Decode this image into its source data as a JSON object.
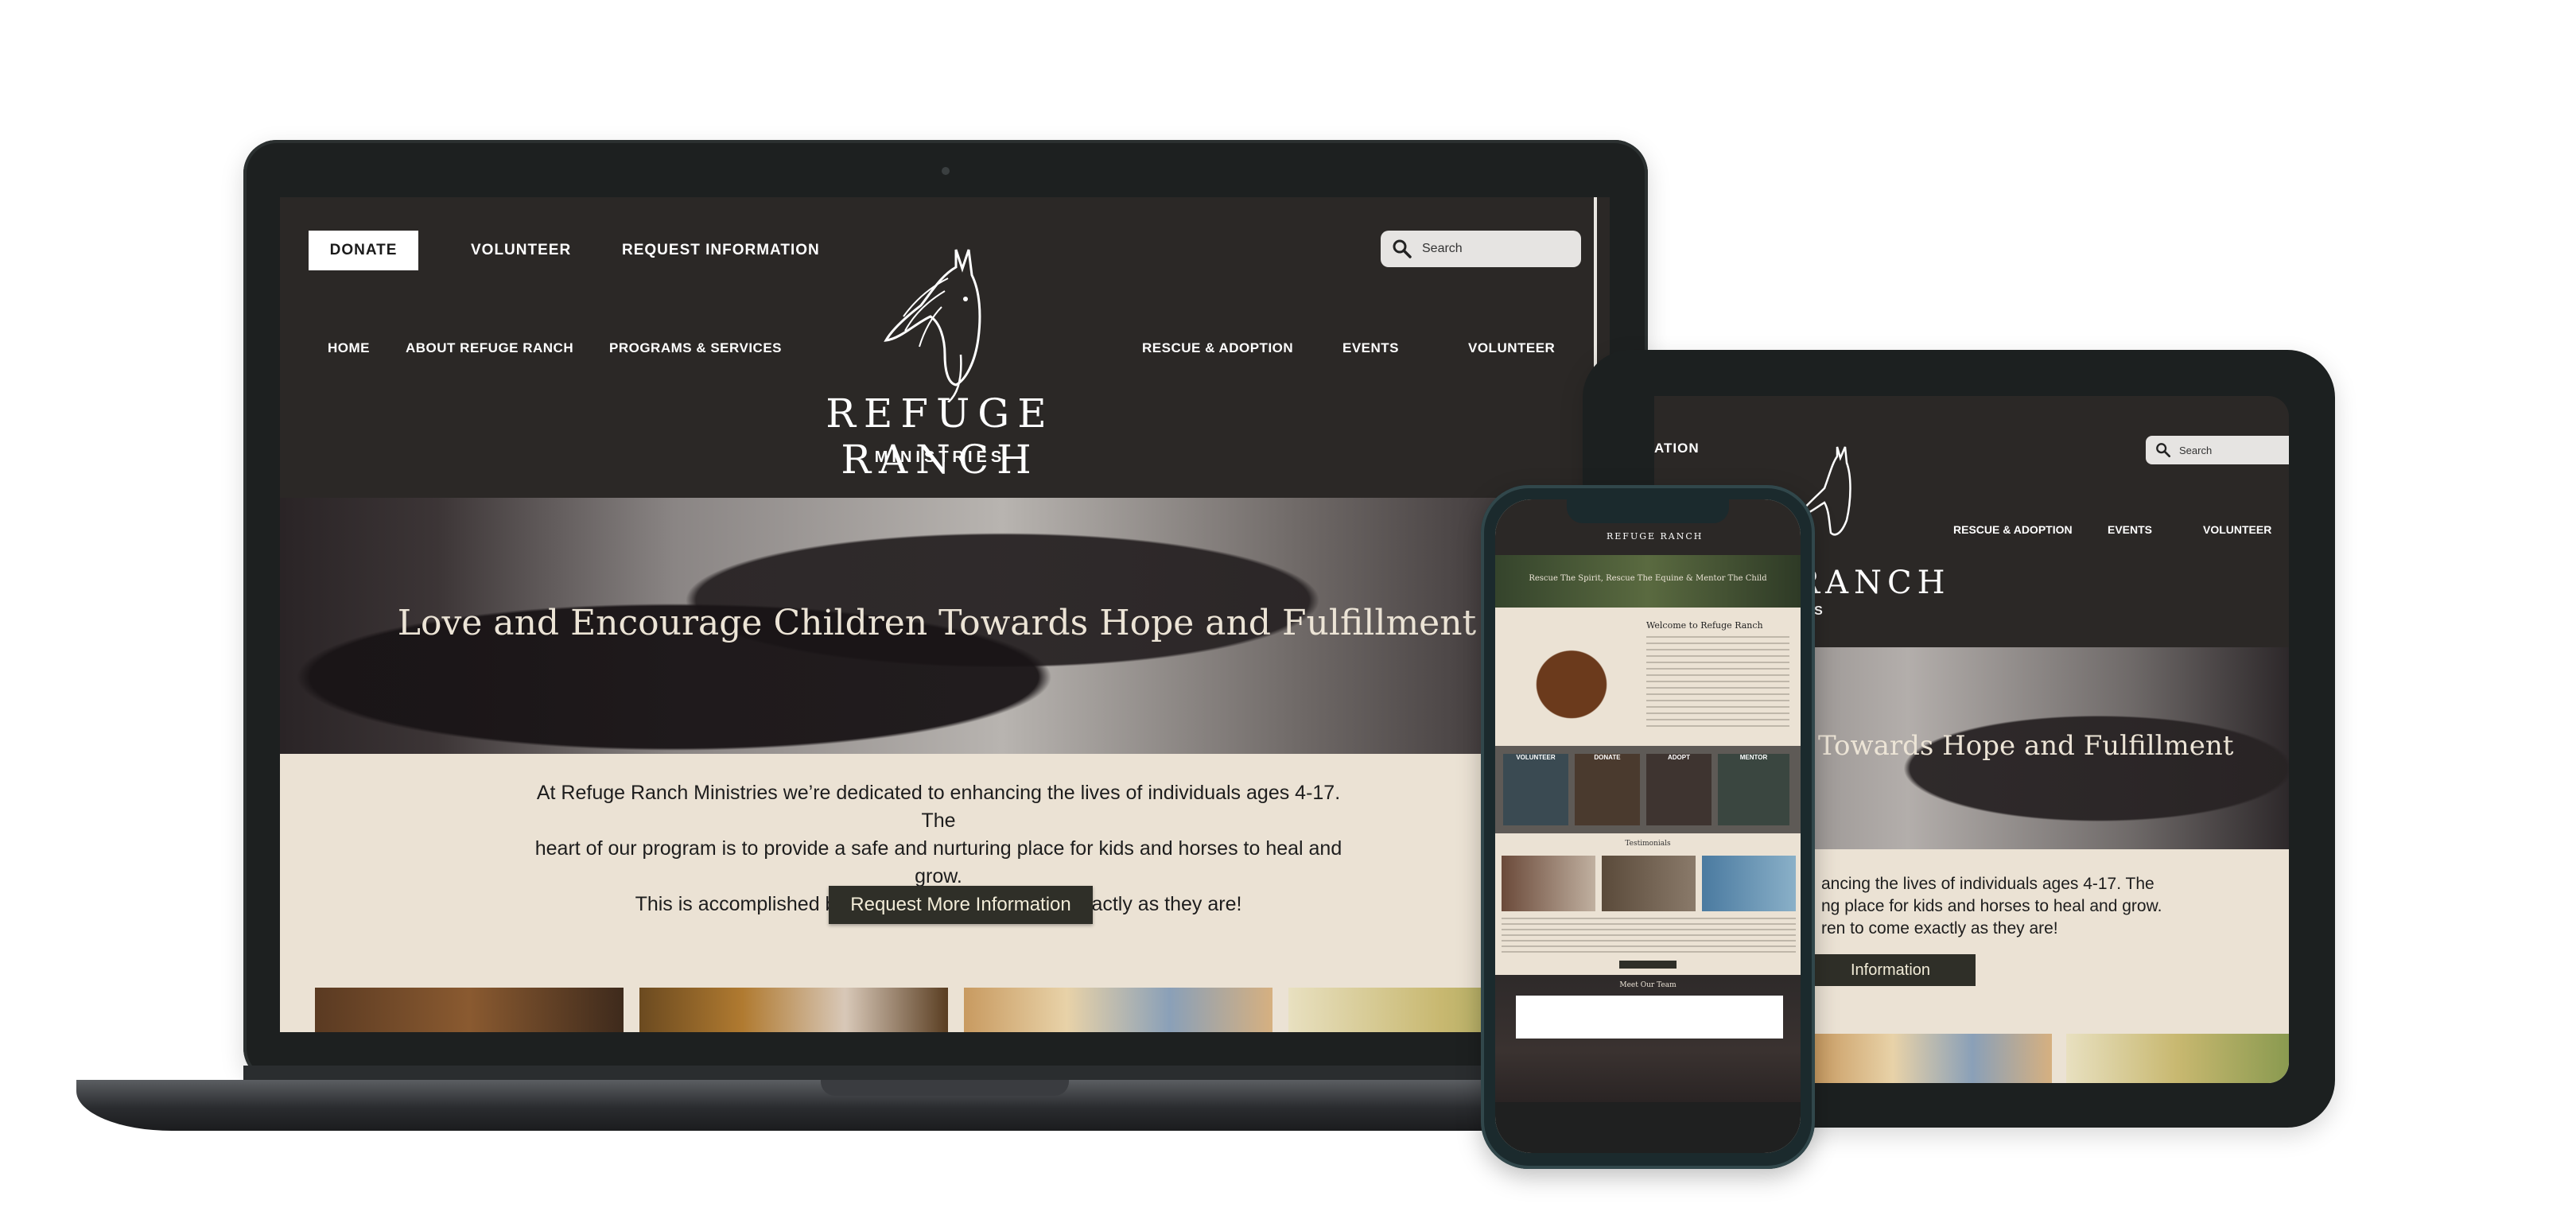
{
  "site": {
    "logo": {
      "title": "REFUGE RANCH",
      "subtitle": "MINISTRIES"
    },
    "top_bar": {
      "donate_label": "DONATE",
      "volunteer_label": "VOLUNTEER",
      "request_info_label": "REQUEST INFORMATION"
    },
    "search": {
      "placeholder": "Search"
    },
    "nav": {
      "home": "HOME",
      "about": "ABOUT REFUGE RANCH",
      "programs": "PROGRAMS & SERVICES",
      "rescue": "RESCUE & ADOPTION",
      "events": "EVENTS",
      "volunteer": "VOLUNTEER"
    },
    "hero": {
      "title": "Love and Encourage Children Towards Hope and Fulfillment"
    },
    "intro": {
      "line1": "At Refuge Ranch Ministries we’re dedicated to enhancing the lives of individuals ages 4-17. The",
      "line2": "heart of our program is to provide a safe and nurturing place for kids and horses to heal and grow.",
      "line3": "This is accomplished by inviting children to come exactly as they are!",
      "button_label": "Request More Information"
    }
  },
  "tablet": {
    "partial_top_link": "ATION",
    "search_placeholder": "Search",
    "nav_rescue": "RESCUE & ADOPTION",
    "nav_events": "EVENTS",
    "nav_volunteer": "VOLUNTEER",
    "logo_partial": "RANCH",
    "logo_sub_partial": "IES",
    "hero_partial": "Towards Hope and Fulfillment",
    "intro_line1": "ancing the lives of individuals ages 4-17. The",
    "intro_line2": "ng place for kids and horses to heal and grow.",
    "intro_line3": "ren to come exactly as they are!",
    "button_partial": "Information"
  },
  "phone": {
    "banner": "Rescue The Spirit, Rescue The Equine & Mentor The Child",
    "welcome_title": "Welcome to Refuge Ranch",
    "cards": [
      "VOLUNTEER",
      "DONATE",
      "ADOPT",
      "MENTOR"
    ],
    "testimonials_title": "Testimonials",
    "team_title": "Meet Our Team"
  },
  "colors": {
    "header_bg": "#2b2826",
    "intro_bg": "#ebe2d4",
    "hero_text": "#ece4d6",
    "button_bg": "#2f2f28",
    "device_frame": "#1d2020"
  }
}
